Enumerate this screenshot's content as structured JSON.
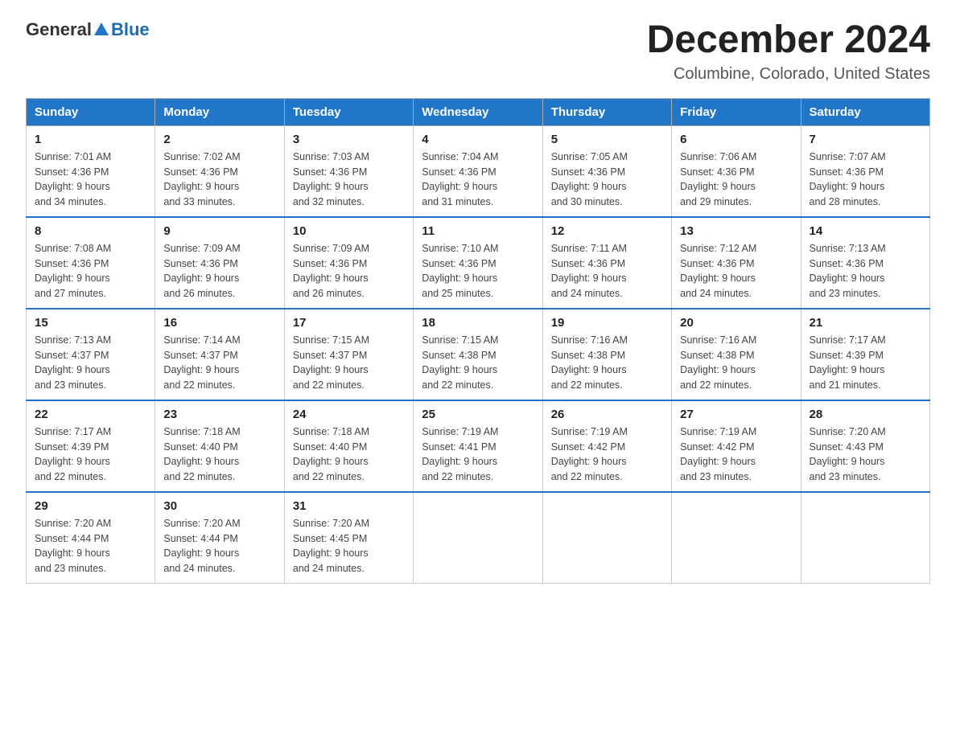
{
  "header": {
    "logo_general": "General",
    "logo_blue": "Blue",
    "month_title": "December 2024",
    "location": "Columbine, Colorado, United States"
  },
  "weekdays": [
    "Sunday",
    "Monday",
    "Tuesday",
    "Wednesday",
    "Thursday",
    "Friday",
    "Saturday"
  ],
  "weeks": [
    [
      {
        "day": "1",
        "sunrise": "7:01 AM",
        "sunset": "4:36 PM",
        "daylight": "9 hours and 34 minutes."
      },
      {
        "day": "2",
        "sunrise": "7:02 AM",
        "sunset": "4:36 PM",
        "daylight": "9 hours and 33 minutes."
      },
      {
        "day": "3",
        "sunrise": "7:03 AM",
        "sunset": "4:36 PM",
        "daylight": "9 hours and 32 minutes."
      },
      {
        "day": "4",
        "sunrise": "7:04 AM",
        "sunset": "4:36 PM",
        "daylight": "9 hours and 31 minutes."
      },
      {
        "day": "5",
        "sunrise": "7:05 AM",
        "sunset": "4:36 PM",
        "daylight": "9 hours and 30 minutes."
      },
      {
        "day": "6",
        "sunrise": "7:06 AM",
        "sunset": "4:36 PM",
        "daylight": "9 hours and 29 minutes."
      },
      {
        "day": "7",
        "sunrise": "7:07 AM",
        "sunset": "4:36 PM",
        "daylight": "9 hours and 28 minutes."
      }
    ],
    [
      {
        "day": "8",
        "sunrise": "7:08 AM",
        "sunset": "4:36 PM",
        "daylight": "9 hours and 27 minutes."
      },
      {
        "day": "9",
        "sunrise": "7:09 AM",
        "sunset": "4:36 PM",
        "daylight": "9 hours and 26 minutes."
      },
      {
        "day": "10",
        "sunrise": "7:09 AM",
        "sunset": "4:36 PM",
        "daylight": "9 hours and 26 minutes."
      },
      {
        "day": "11",
        "sunrise": "7:10 AM",
        "sunset": "4:36 PM",
        "daylight": "9 hours and 25 minutes."
      },
      {
        "day": "12",
        "sunrise": "7:11 AM",
        "sunset": "4:36 PM",
        "daylight": "9 hours and 24 minutes."
      },
      {
        "day": "13",
        "sunrise": "7:12 AM",
        "sunset": "4:36 PM",
        "daylight": "9 hours and 24 minutes."
      },
      {
        "day": "14",
        "sunrise": "7:13 AM",
        "sunset": "4:36 PM",
        "daylight": "9 hours and 23 minutes."
      }
    ],
    [
      {
        "day": "15",
        "sunrise": "7:13 AM",
        "sunset": "4:37 PM",
        "daylight": "9 hours and 23 minutes."
      },
      {
        "day": "16",
        "sunrise": "7:14 AM",
        "sunset": "4:37 PM",
        "daylight": "9 hours and 22 minutes."
      },
      {
        "day": "17",
        "sunrise": "7:15 AM",
        "sunset": "4:37 PM",
        "daylight": "9 hours and 22 minutes."
      },
      {
        "day": "18",
        "sunrise": "7:15 AM",
        "sunset": "4:38 PM",
        "daylight": "9 hours and 22 minutes."
      },
      {
        "day": "19",
        "sunrise": "7:16 AM",
        "sunset": "4:38 PM",
        "daylight": "9 hours and 22 minutes."
      },
      {
        "day": "20",
        "sunrise": "7:16 AM",
        "sunset": "4:38 PM",
        "daylight": "9 hours and 22 minutes."
      },
      {
        "day": "21",
        "sunrise": "7:17 AM",
        "sunset": "4:39 PM",
        "daylight": "9 hours and 21 minutes."
      }
    ],
    [
      {
        "day": "22",
        "sunrise": "7:17 AM",
        "sunset": "4:39 PM",
        "daylight": "9 hours and 22 minutes."
      },
      {
        "day": "23",
        "sunrise": "7:18 AM",
        "sunset": "4:40 PM",
        "daylight": "9 hours and 22 minutes."
      },
      {
        "day": "24",
        "sunrise": "7:18 AM",
        "sunset": "4:40 PM",
        "daylight": "9 hours and 22 minutes."
      },
      {
        "day": "25",
        "sunrise": "7:19 AM",
        "sunset": "4:41 PM",
        "daylight": "9 hours and 22 minutes."
      },
      {
        "day": "26",
        "sunrise": "7:19 AM",
        "sunset": "4:42 PM",
        "daylight": "9 hours and 22 minutes."
      },
      {
        "day": "27",
        "sunrise": "7:19 AM",
        "sunset": "4:42 PM",
        "daylight": "9 hours and 23 minutes."
      },
      {
        "day": "28",
        "sunrise": "7:20 AM",
        "sunset": "4:43 PM",
        "daylight": "9 hours and 23 minutes."
      }
    ],
    [
      {
        "day": "29",
        "sunrise": "7:20 AM",
        "sunset": "4:44 PM",
        "daylight": "9 hours and 23 minutes."
      },
      {
        "day": "30",
        "sunrise": "7:20 AM",
        "sunset": "4:44 PM",
        "daylight": "9 hours and 24 minutes."
      },
      {
        "day": "31",
        "sunrise": "7:20 AM",
        "sunset": "4:45 PM",
        "daylight": "9 hours and 24 minutes."
      },
      null,
      null,
      null,
      null
    ]
  ],
  "labels": {
    "sunrise_prefix": "Sunrise: ",
    "sunset_prefix": "Sunset: ",
    "daylight_prefix": "Daylight: "
  }
}
